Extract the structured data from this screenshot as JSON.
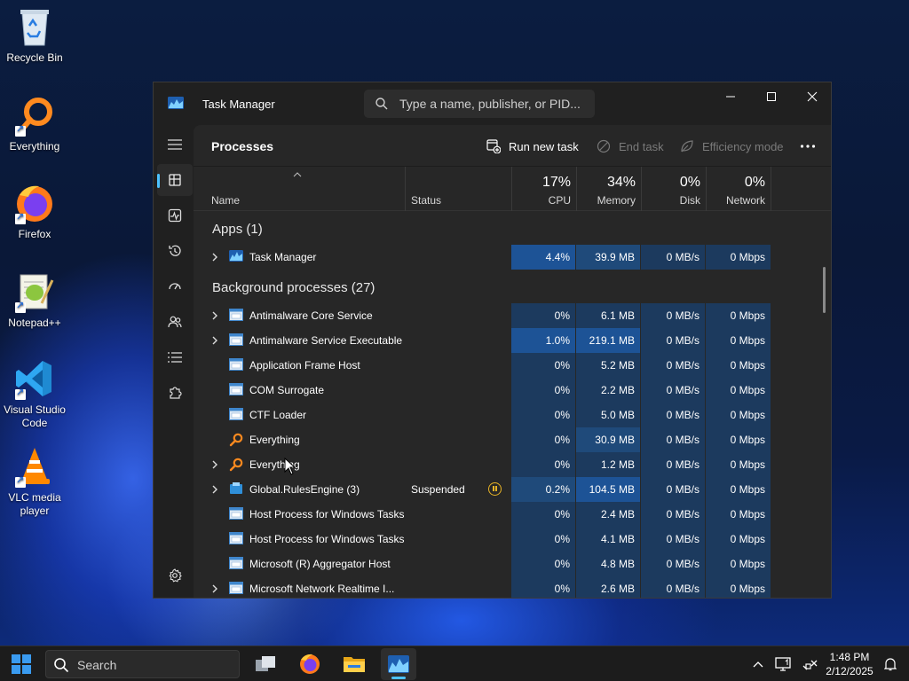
{
  "desktop": {
    "icons": [
      {
        "label": "Recycle Bin",
        "icon": "recycle-bin-icon"
      },
      {
        "label": "Everything",
        "icon": "everything-icon"
      },
      {
        "label": "Firefox",
        "icon": "firefox-icon"
      },
      {
        "label": "Notepad++",
        "icon": "notepad-plus-plus-icon"
      },
      {
        "label": "Visual Studio Code",
        "icon": "vscode-icon"
      },
      {
        "label": "VLC media player",
        "icon": "vlc-icon"
      }
    ]
  },
  "task_manager": {
    "title": "Task Manager",
    "search_placeholder": "Type a name, publisher, or PID...",
    "page_title": "Processes",
    "toolbar": {
      "run_new_task": "Run new task",
      "end_task": "End task",
      "efficiency_mode": "Efficiency mode"
    },
    "columns": {
      "name": "Name",
      "status": "Status",
      "cpu_pct": "17%",
      "cpu": "CPU",
      "memory_pct": "34%",
      "memory": "Memory",
      "disk_pct": "0%",
      "disk": "Disk",
      "network_pct": "0%",
      "network": "Network"
    },
    "sections": {
      "apps": "Apps (1)",
      "background": "Background processes (27)"
    },
    "apps": [
      {
        "name": "Task Manager",
        "expandable": true,
        "icon": "task-manager-icon",
        "status": "",
        "cpu": "4.4%",
        "memory": "39.9 MB",
        "disk": "0 MB/s",
        "network": "0 Mbps"
      }
    ],
    "background": [
      {
        "name": "Antimalware Core Service",
        "expandable": true,
        "icon": "window-icon",
        "status": "",
        "cpu": "0%",
        "memory": "6.1 MB",
        "disk": "0 MB/s",
        "network": "0 Mbps"
      },
      {
        "name": "Antimalware Service Executable",
        "expandable": true,
        "icon": "window-icon",
        "status": "",
        "cpu": "1.0%",
        "memory": "219.1 MB",
        "disk": "0 MB/s",
        "network": "0 Mbps"
      },
      {
        "name": "Application Frame Host",
        "expandable": false,
        "icon": "window-icon",
        "status": "",
        "cpu": "0%",
        "memory": "5.2 MB",
        "disk": "0 MB/s",
        "network": "0 Mbps"
      },
      {
        "name": "COM Surrogate",
        "expandable": false,
        "icon": "window-icon",
        "status": "",
        "cpu": "0%",
        "memory": "2.2 MB",
        "disk": "0 MB/s",
        "network": "0 Mbps"
      },
      {
        "name": "CTF Loader",
        "expandable": false,
        "icon": "window-icon",
        "status": "",
        "cpu": "0%",
        "memory": "5.0 MB",
        "disk": "0 MB/s",
        "network": "0 Mbps"
      },
      {
        "name": "Everything",
        "expandable": false,
        "icon": "everything-icon",
        "status": "",
        "cpu": "0%",
        "memory": "30.9 MB",
        "disk": "0 MB/s",
        "network": "0 Mbps"
      },
      {
        "name": "Everything",
        "expandable": true,
        "icon": "everything-icon",
        "status": "",
        "cpu": "0%",
        "memory": "1.2 MB",
        "disk": "0 MB/s",
        "network": "0 Mbps"
      },
      {
        "name": "Global.RulesEngine (3)",
        "expandable": true,
        "icon": "rules-engine-icon",
        "status": "Suspended",
        "cpu": "0.2%",
        "memory": "104.5 MB",
        "disk": "0 MB/s",
        "network": "0 Mbps"
      },
      {
        "name": "Host Process for Windows Tasks",
        "expandable": false,
        "icon": "window-icon",
        "status": "",
        "cpu": "0%",
        "memory": "2.4 MB",
        "disk": "0 MB/s",
        "network": "0 Mbps"
      },
      {
        "name": "Host Process for Windows Tasks",
        "expandable": false,
        "icon": "window-icon",
        "status": "",
        "cpu": "0%",
        "memory": "4.1 MB",
        "disk": "0 MB/s",
        "network": "0 Mbps"
      },
      {
        "name": "Microsoft (R) Aggregator Host",
        "expandable": false,
        "icon": "window-icon",
        "status": "",
        "cpu": "0%",
        "memory": "4.8 MB",
        "disk": "0 MB/s",
        "network": "0 Mbps"
      },
      {
        "name": "Microsoft Network Realtime I...",
        "expandable": true,
        "icon": "window-icon",
        "status": "",
        "cpu": "0%",
        "memory": "2.6 MB",
        "disk": "0 MB/s",
        "network": "0 Mbps"
      }
    ]
  },
  "taskbar": {
    "search_label": "Search",
    "time": "1:48 PM",
    "date": "2/12/2025"
  },
  "colors": {
    "accent": "#4cc2ff",
    "heat_low": "#1c3a5e",
    "heat_mid": "#1f4a7a",
    "heat_high": "#1d5396",
    "suspended": "#e8b326"
  }
}
